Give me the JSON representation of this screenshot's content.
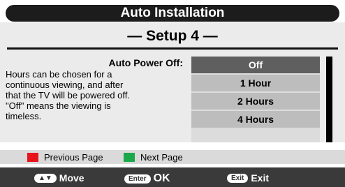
{
  "window": {
    "title": "Auto Installation"
  },
  "setup": {
    "title": "— Setup 4 —"
  },
  "description": {
    "heading": "Auto Power Off:",
    "lines": [
      "Hours can be chosen for a",
      "continuous viewing, and after",
      "that the TV will be powered off.",
      "\"Off\" means the viewing is",
      "timeless."
    ]
  },
  "options": {
    "items": [
      "Off",
      "1 Hour",
      "2 Hours",
      "4 Hours"
    ],
    "selected": "Off"
  },
  "page_nav": {
    "previous_label": "Previous Page",
    "previous_color": "#e8141c",
    "next_label": "Next Page",
    "next_color": "#1aa84a"
  },
  "key_hints": {
    "move_key": "▲▼",
    "move_label": "Move",
    "enter_key": "Enter",
    "enter_label": "OK",
    "exit_key": "Exit",
    "exit_label": "Exit"
  }
}
